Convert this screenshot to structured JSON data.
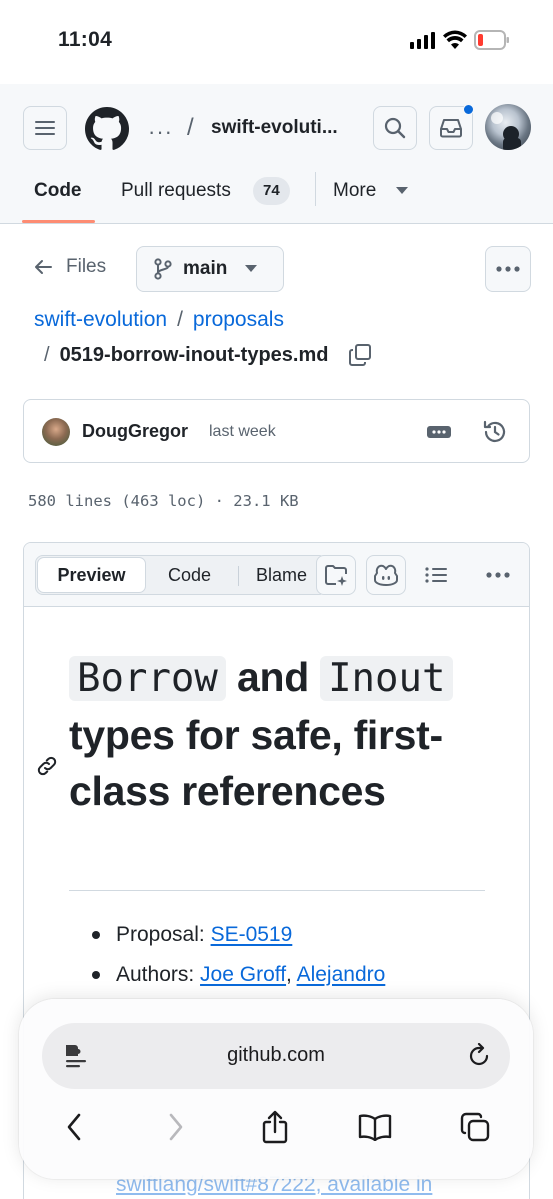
{
  "status_bar": {
    "time": "11:04"
  },
  "header": {
    "repo_ellipsis": "···",
    "path_separator": "/",
    "repo_name": "swift-evoluti...",
    "tabs": [
      {
        "label": "Code",
        "active": true
      },
      {
        "label": "Pull requests",
        "count": "74"
      },
      {
        "label": "More"
      }
    ]
  },
  "file_nav": {
    "back_label": "Files",
    "branch": "main",
    "breadcrumb_repo": "swift-evolution",
    "breadcrumb_sep": "/",
    "breadcrumb_dir": "proposals",
    "file_name": "0519-borrow-inout-types.md"
  },
  "commit": {
    "author": "DougGregor",
    "time": "last week"
  },
  "file_meta": "580 lines (463 loc) · 23.1 KB",
  "viewer": {
    "tabs": [
      "Preview",
      "Code",
      "Blame"
    ],
    "active_tab": "Preview"
  },
  "document": {
    "title_code_1": "Borrow",
    "title_word_and": "and",
    "title_code_2": "Inout",
    "title_rest": "types for safe, first-class references",
    "proposal_label": "Proposal: ",
    "proposal_link": "SE-0519",
    "authors_label": "Authors: ",
    "author_1": "Joe Groff",
    "author_sep": ", ",
    "author_2": "Alejandro",
    "faded_link_text": "swiftlang/swift#87222, available in"
  },
  "browser": {
    "url": "github.com"
  },
  "colors": {
    "link": "#0969da",
    "tab_underline": "#fd8c73",
    "notification": "#0969da",
    "battery_low": "#ff3b30"
  }
}
